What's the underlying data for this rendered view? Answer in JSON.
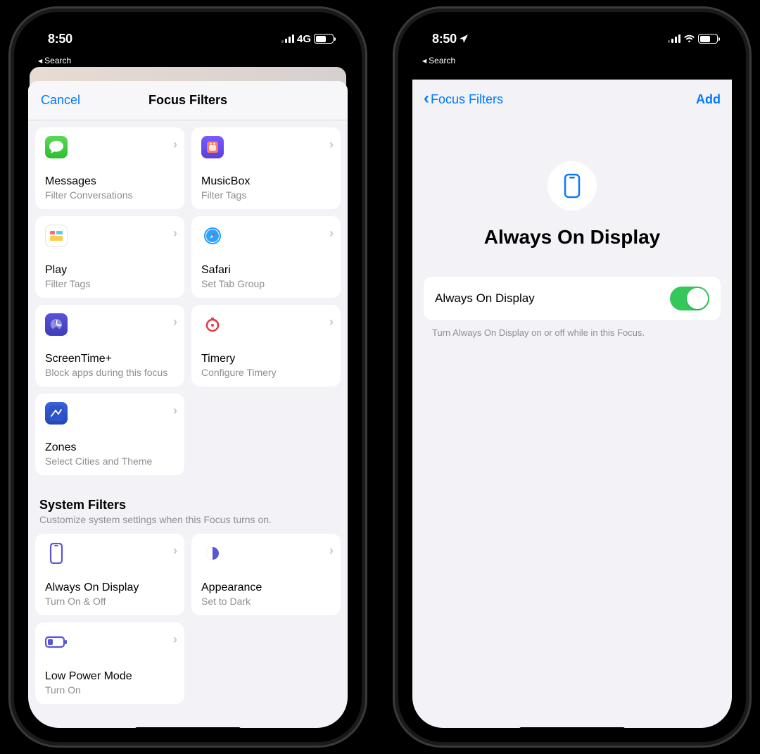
{
  "left": {
    "status": {
      "time": "8:50",
      "back": "Search",
      "network": "4G"
    },
    "header": {
      "cancel": "Cancel",
      "title": "Focus Filters"
    },
    "app_filters": [
      {
        "title": "Messages",
        "sub": "Filter Conversations"
      },
      {
        "title": "MusicBox",
        "sub": "Filter Tags"
      },
      {
        "title": "Play",
        "sub": "Filter Tags"
      },
      {
        "title": "Safari",
        "sub": "Set Tab Group"
      },
      {
        "title": "ScreenTime+",
        "sub": "Block apps during this focus"
      },
      {
        "title": "Timery",
        "sub": "Configure Timery"
      },
      {
        "title": "Zones",
        "sub": "Select Cities and Theme"
      }
    ],
    "system_section": {
      "title": "System Filters",
      "sub": "Customize system settings when this Focus turns on."
    },
    "system_filters": [
      {
        "title": "Always On Display",
        "sub": "Turn On & Off"
      },
      {
        "title": "Appearance",
        "sub": "Set to Dark"
      },
      {
        "title": "Low Power Mode",
        "sub": "Turn On"
      }
    ]
  },
  "right": {
    "status": {
      "time": "8:50",
      "back": "Search"
    },
    "nav": {
      "back": "Focus Filters",
      "add": "Add"
    },
    "hero": {
      "title": "Always On Display"
    },
    "setting": {
      "label": "Always On Display",
      "enabled": true
    },
    "footer": "Turn Always On Display on or off while in this Focus."
  }
}
